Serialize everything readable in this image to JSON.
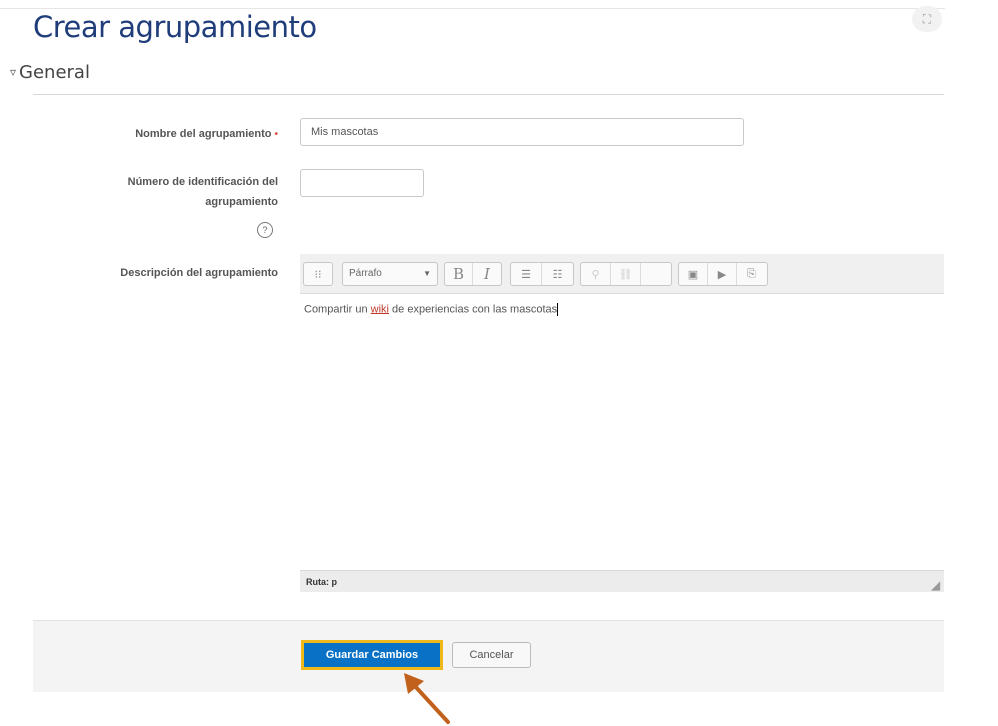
{
  "header": {
    "title": "Crear agrupamiento",
    "expand_icon": "fullscreen-icon",
    "expand_glyph": "⛶"
  },
  "section": {
    "title": "General",
    "toggle_glyph": "▿"
  },
  "form": {
    "name_label": "Nombre del agrupamiento",
    "name_required_marker": "•",
    "name_value": "Mis mascotas",
    "idnumber_label_line1": "Número de identificación del",
    "idnumber_label_line2": "agrupamiento",
    "idnumber_value": "",
    "help_glyph": "?",
    "description_label": "Descripción del agrupamiento"
  },
  "editor": {
    "paragraph_select": "Párrafo",
    "toolbar_toggle_glyph": "⁝⁝",
    "bold_glyph": "B",
    "italic_glyph": "I",
    "ul_glyph": "☰",
    "ol_glyph": "☷",
    "link_glyph": "⚲",
    "unlink_glyph": "⛓",
    "blank_glyph": "",
    "image_glyph": "▣",
    "media_glyph": "▶",
    "manage_files_glyph": "⎘",
    "content_before": "Compartir un ",
    "content_link": "wiki",
    "content_after": " de experiencias con las mascotas",
    "path": "Ruta: p",
    "resize_glyph": "◢"
  },
  "actions": {
    "save_label": "Guardar Cambios",
    "cancel_label": "Cancelar"
  },
  "colors": {
    "title": "#1f3d7a",
    "primary": "#0a72c6",
    "highlight": "#f0b81a",
    "arrow": "#c1611c"
  }
}
